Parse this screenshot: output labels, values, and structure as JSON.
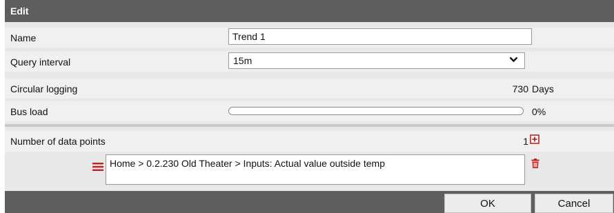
{
  "dialog": {
    "title": "Edit"
  },
  "fields": {
    "name": {
      "label": "Name",
      "value": "Trend 1"
    },
    "query_interval": {
      "label": "Query interval",
      "value": "15m"
    },
    "circular_logging": {
      "label": "Circular logging",
      "value": "730",
      "unit": "Days"
    },
    "bus_load": {
      "label": "Bus load",
      "value": "0%",
      "fraction": 0
    }
  },
  "data_points": {
    "label": "Number of data points",
    "count": "1",
    "items": [
      {
        "path": "Home > 0.2.230 Old Theater > Inputs: Actual value outside temp"
      }
    ]
  },
  "buttons": {
    "ok": "OK",
    "cancel": "Cancel"
  },
  "colors": {
    "titlebar": "#5e5e5e",
    "accent_red": "#c0211f",
    "row_bg": "#f0f0f0"
  },
  "icons": {
    "add": "plus-square-icon",
    "drag": "hamburger-icon",
    "delete": "trash-icon",
    "dropdown": "chevron-down-icon"
  }
}
